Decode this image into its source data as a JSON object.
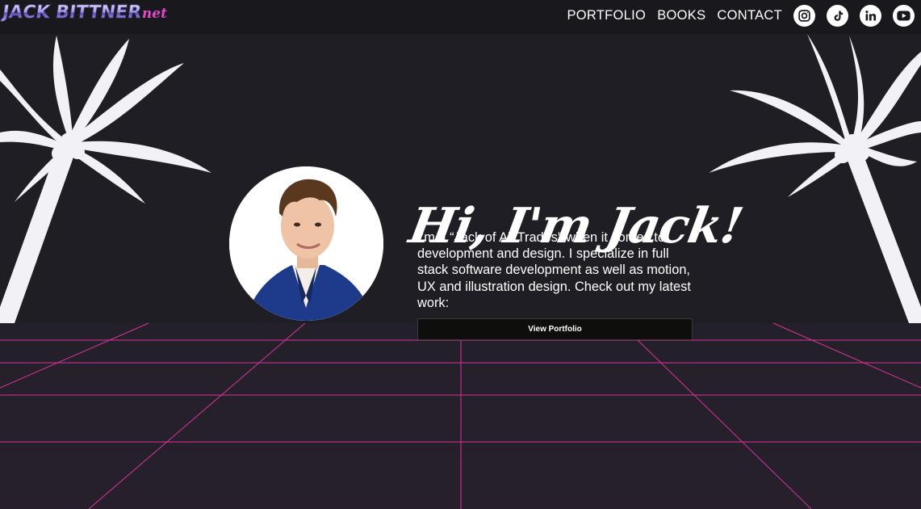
{
  "header": {
    "logo_main": "JACK BITTNER",
    "logo_suffix": "net",
    "nav": [
      "PORTFOLIO",
      "BOOKS",
      "CONTACT"
    ],
    "social_icons": [
      "instagram-icon",
      "tiktok-icon",
      "linkedin-icon",
      "youtube-icon"
    ]
  },
  "hero": {
    "headline": "Hi, I'm Jack!",
    "bio": "I’m a “Jack of All Trades” when it comes to development and design. I specialize in full stack software development as well as motion, UX and illustration design. Check out my latest work:",
    "cta_label": "View Portfolio"
  },
  "colors": {
    "background": "#1f1e24",
    "navbar": "#19181c",
    "grid_line": "#d6349a",
    "palm": "#f2f2f6",
    "button": "#0e0f0c"
  }
}
